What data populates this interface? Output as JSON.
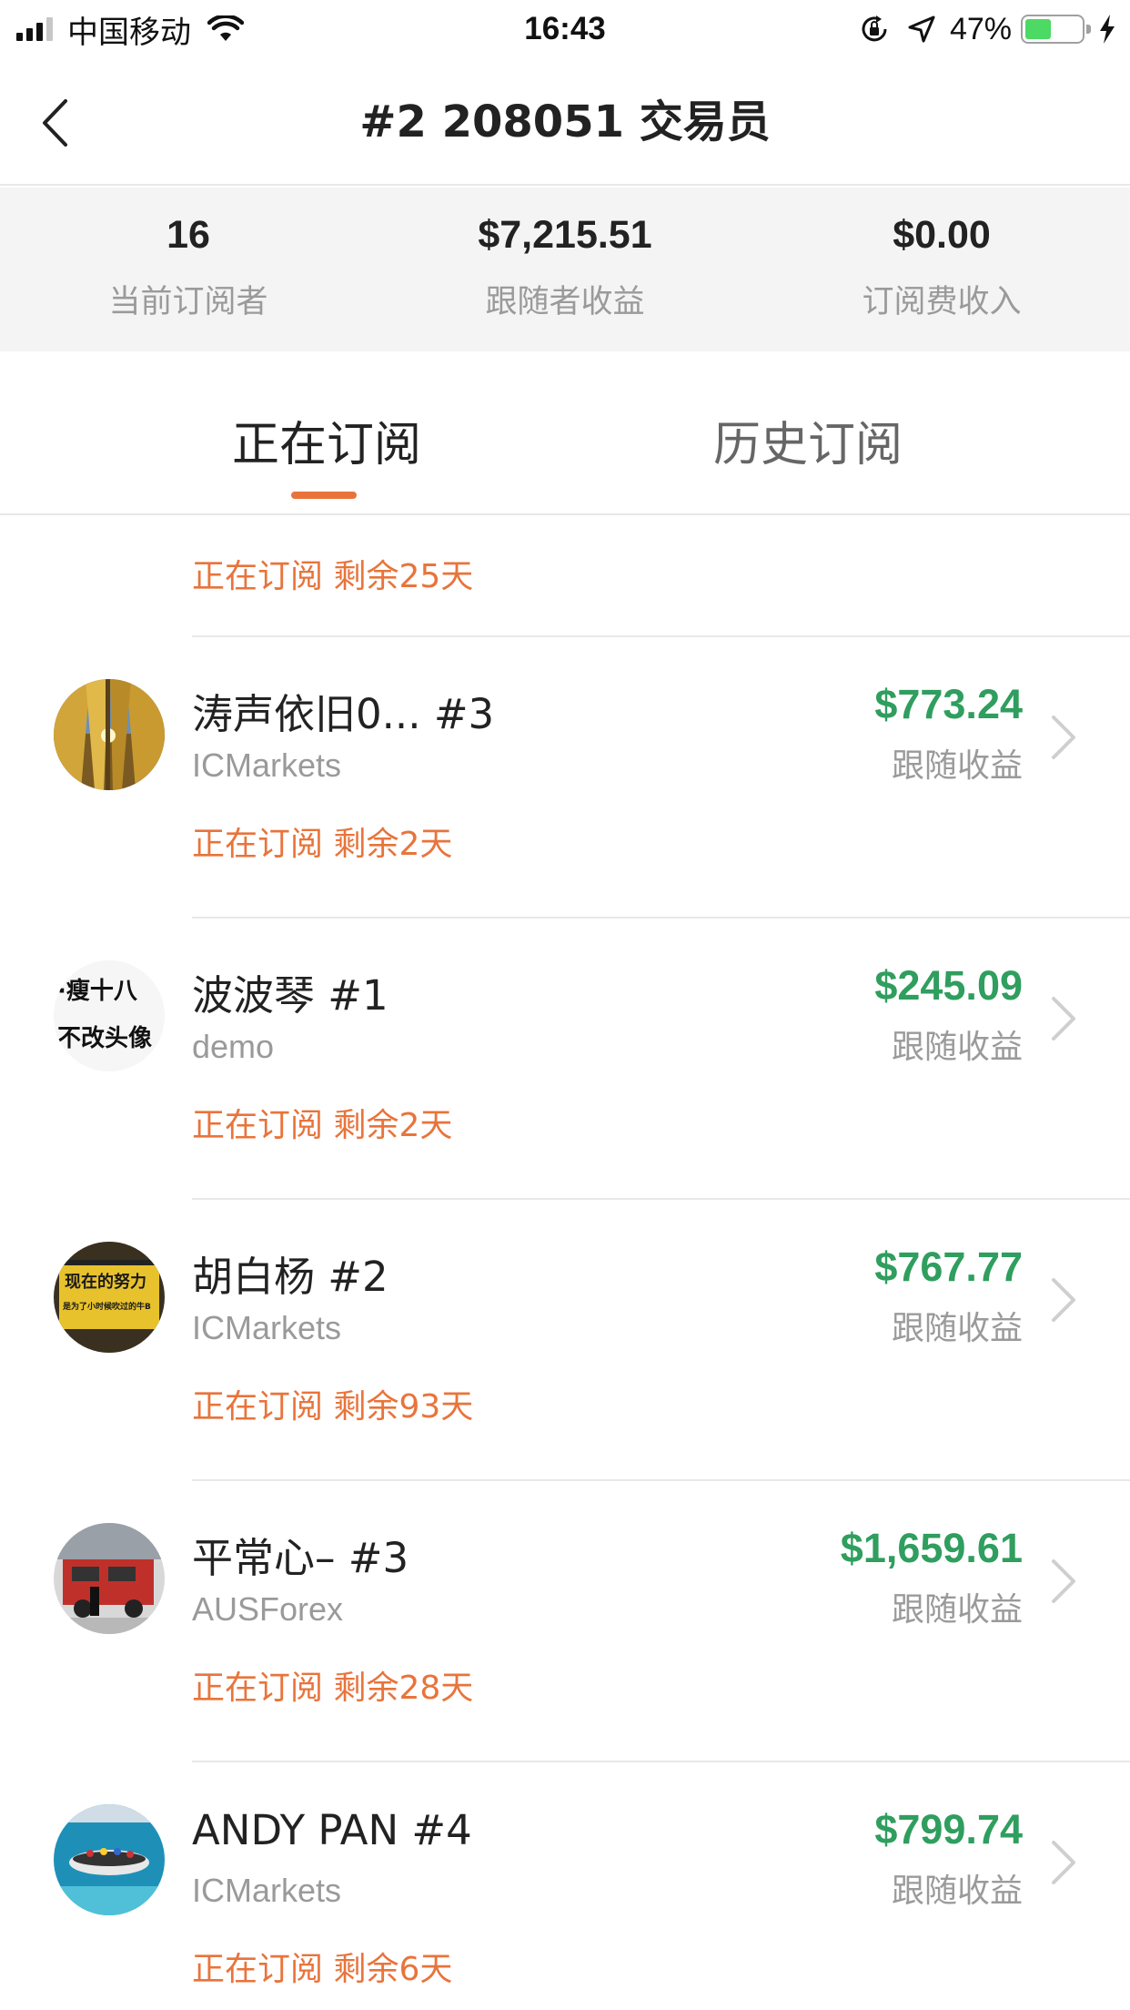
{
  "status_bar": {
    "carrier": "中国移动",
    "time": "16:43",
    "battery_percent": "47%",
    "battery_level": 0.47
  },
  "nav": {
    "title": "#2 208051 交易员"
  },
  "stats": [
    {
      "value": "16",
      "label": "当前订阅者"
    },
    {
      "value": "$7,215.51",
      "label": "跟随者收益"
    },
    {
      "value": "$0.00",
      "label": "订阅费收入"
    }
  ],
  "tabs": {
    "active": "正在订阅",
    "history": "历史订阅"
  },
  "partial_item": {
    "status": "正在订阅 剩余25天"
  },
  "subscribers": [
    {
      "name": "涛声依旧0...   #3",
      "broker": "ICMarkets",
      "amount": "$773.24",
      "amount_label": "跟随收益",
      "status": "正在订阅 剩余2天",
      "avatar": "forest-avatar"
    },
    {
      "name": "波波琴 #1",
      "broker": "demo",
      "amount": "$245.09",
      "amount_label": "跟随收益",
      "status": "正在订阅 剩余2天",
      "avatar": "text-avatar"
    },
    {
      "name": "胡白杨 #2",
      "broker": "ICMarkets",
      "amount": "$767.77",
      "amount_label": "跟随收益",
      "status": "正在订阅 剩余93天",
      "avatar": "sign-avatar"
    },
    {
      "name": "平常心– #3",
      "broker": "AUSForex",
      "amount": "$1,659.61",
      "amount_label": "跟随收益",
      "status": "正在订阅 剩余28天",
      "avatar": "firetruck-avatar"
    },
    {
      "name": "ANDY PAN #4",
      "broker": "ICMarkets",
      "amount": "$799.74",
      "amount_label": "跟随收益",
      "status": "正在订阅 剩余6天",
      "avatar": "boat-avatar"
    }
  ],
  "avatar_text": {
    "text_avatar_line1": "​·瘦十八",
    "text_avatar_line2": "不改头像",
    "sign_line1": "现在的努力",
    "sign_line2": "是为了小时候吹过的牛B"
  },
  "colors": {
    "accent_orange": "#e8743b",
    "profit_green": "#2f9e5e",
    "stats_bg": "#f4f4f4"
  }
}
